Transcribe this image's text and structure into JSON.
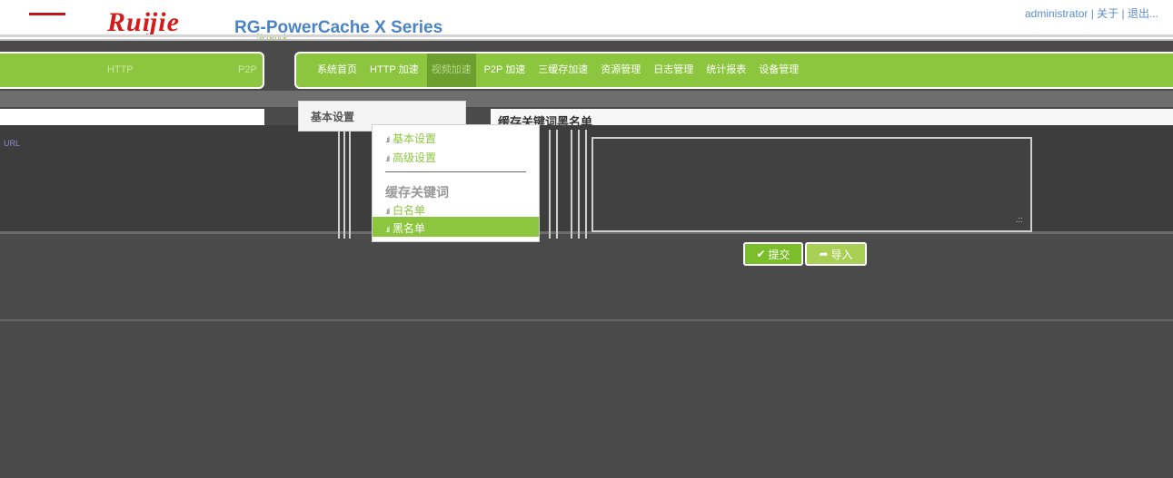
{
  "header": {
    "logo": "Ruĳie",
    "product": "RG-PowerCache X Series",
    "tagline": "Network",
    "user_links": {
      "user": "administrator",
      "about": "关于",
      "logout": "退出..."
    }
  },
  "left_bar": {
    "http_label": "HTTP",
    "p2p_label": "P2P"
  },
  "nav": {
    "items": [
      {
        "label": "系统首页"
      },
      {
        "label": "HTTP 加速"
      },
      {
        "label": "视频加速"
      },
      {
        "label": "P2P 加速"
      },
      {
        "label": "三缓存加速"
      },
      {
        "label": "资源管理"
      },
      {
        "label": "日志管理"
      },
      {
        "label": "统计报表"
      },
      {
        "label": "设备管理"
      }
    ],
    "active_index": 2
  },
  "side_panel": {
    "header": "基本设置"
  },
  "menu": {
    "items": [
      {
        "label": "基本设置"
      },
      {
        "label": "高级设置"
      }
    ],
    "section_title": "缓存关键词",
    "section_items": [
      {
        "label": "白名单"
      },
      {
        "label": "黑名单"
      }
    ],
    "active": "黑名单"
  },
  "content": {
    "title": "缓存关键词黑名单",
    "strip_text_left": "URL",
    "textarea_value": ""
  },
  "buttons": {
    "submit": "提交",
    "import": "导入"
  },
  "colors": {
    "accent": "#8cc63f",
    "logo_red": "#d21b1b",
    "product_blue": "#4b84c4",
    "background": "#4a4a4a"
  }
}
